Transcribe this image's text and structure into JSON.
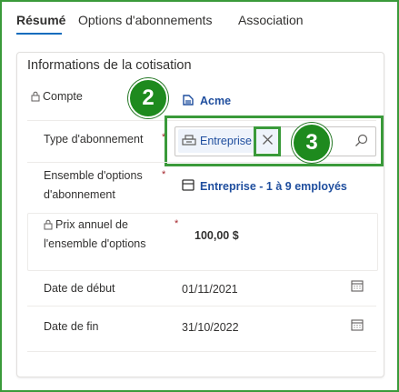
{
  "tabs": [
    {
      "label": "Résumé"
    },
    {
      "label": "Options d'abonnements"
    },
    {
      "label": "Association"
    }
  ],
  "section": {
    "title": "Informations de la cotisation",
    "fields": {
      "compte": {
        "label": "Compte",
        "value": "Acme",
        "required": ""
      },
      "type_abonnement": {
        "label": "Type d'abonnement",
        "value": "Entreprise",
        "required": "*"
      },
      "ensemble_options": {
        "label": "Ensemble d'options d'abonnement",
        "value": "Entreprise - 1 à 9 employés",
        "required": "*"
      },
      "prix_annuel": {
        "label": "Prix annuel de l'ensemble d'options",
        "value": "100,00 $",
        "required": "*"
      },
      "date_debut": {
        "label": "Date de début",
        "value": "01/11/2021"
      },
      "date_fin": {
        "label": "Date de fin",
        "value": "31/10/2022"
      }
    }
  },
  "callouts": {
    "step2": "2",
    "step3": "3"
  },
  "colors": {
    "accent": "#0f6cbd",
    "link": "#1f4e9e",
    "highlight": "#3a9a3a",
    "required": "#a4262c"
  },
  "icons": [
    "lock-icon",
    "account-icon",
    "subscription-type-icon",
    "clear-icon",
    "search-icon",
    "option-set-icon",
    "calendar-icon"
  ]
}
